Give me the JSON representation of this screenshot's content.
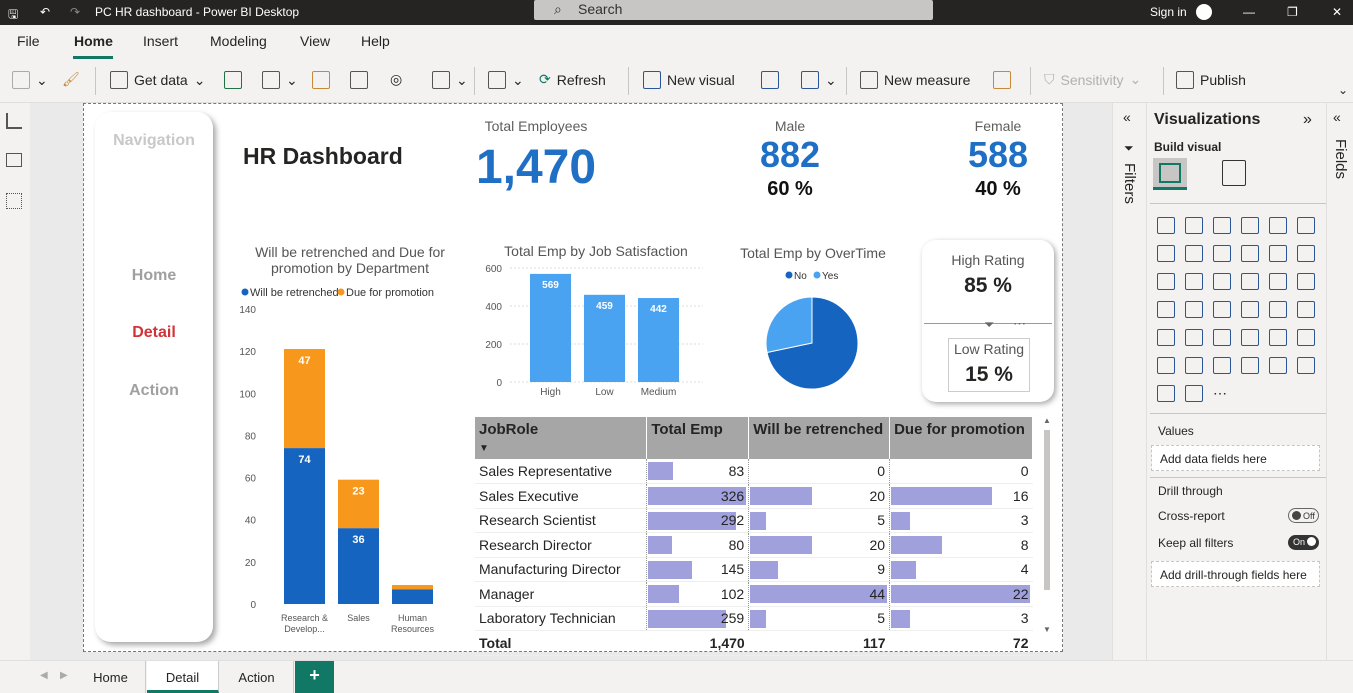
{
  "titlebar": {
    "title": "PC HR dashboard - Power BI Desktop",
    "search_placeholder": "Search",
    "sign_in": "Sign in"
  },
  "menu": [
    "File",
    "Home",
    "Insert",
    "Modeling",
    "View",
    "Help"
  ],
  "ribbon": {
    "get_data": "Get data",
    "refresh": "Refresh",
    "new_visual": "New visual",
    "new_measure": "New measure",
    "sensitivity": "Sensitivity",
    "publish": "Publish"
  },
  "navigation": {
    "title": "Navigation",
    "items": [
      "Home",
      "Detail",
      "Action"
    ],
    "active": "Detail",
    "active_color": "#d13438"
  },
  "report": {
    "title": "HR Dashboard",
    "total_employees": {
      "label": "Total Employees",
      "value": "1,470"
    },
    "male": {
      "label": "Male",
      "value": "882",
      "pct": "60 %"
    },
    "female": {
      "label": "Female",
      "value": "588",
      "pct": "40 %"
    },
    "high_rating": {
      "label": "High Rating",
      "value": "85 %"
    },
    "low_rating": {
      "label": "Low Rating",
      "value": "15 %"
    }
  },
  "chart_data": [
    {
      "type": "bar",
      "stacked": true,
      "title": "Will be retrenched and Due for promotion by Department",
      "categories": [
        "Research & Develop...",
        "Sales",
        "Human Resources"
      ],
      "series": [
        {
          "name": "Will be retrenched",
          "values": [
            74,
            36,
            7
          ],
          "color": "#1565c0"
        },
        {
          "name": "Due for promotion",
          "values": [
            47,
            23,
            2
          ],
          "color": "#f7981d"
        }
      ],
      "yticks": [
        "0",
        "20",
        "40",
        "60",
        "80",
        "100",
        "120",
        "140"
      ],
      "ylim": [
        0,
        140
      ],
      "legend": "top"
    },
    {
      "type": "bar",
      "title": "Total Emp by Job Satisfaction",
      "categories": [
        "High",
        "Low",
        "Medium"
      ],
      "values": [
        569,
        459,
        442
      ],
      "yticks": [
        "0",
        "200",
        "400",
        "600"
      ],
      "ylim": [
        0,
        600
      ],
      "color": "#4aa3f0"
    },
    {
      "type": "pie",
      "title": "Total Emp by OverTime",
      "series": [
        {
          "name": "No",
          "value": 1054,
          "color": "#1565c0"
        },
        {
          "name": "Yes",
          "value": 416,
          "color": "#4aa3f0"
        }
      ],
      "legend": "top"
    }
  ],
  "table": {
    "columns": [
      "JobRole",
      "Total Emp",
      "Will be retrenched",
      "Due for promotion"
    ],
    "rows": [
      {
        "role": "Sales Representative",
        "total": 83,
        "retrenched": 0,
        "promotion": 0
      },
      {
        "role": "Sales Executive",
        "total": 326,
        "retrenched": 20,
        "promotion": 16
      },
      {
        "role": "Research Scientist",
        "total": 292,
        "retrenched": 5,
        "promotion": 3
      },
      {
        "role": "Research Director",
        "total": 80,
        "retrenched": 20,
        "promotion": 8
      },
      {
        "role": "Manufacturing Director",
        "total": 145,
        "retrenched": 9,
        "promotion": 4
      },
      {
        "role": "Manager",
        "total": 102,
        "retrenched": 44,
        "promotion": 22
      },
      {
        "role": "Laboratory Technician",
        "total": 259,
        "retrenched": 5,
        "promotion": 3
      }
    ],
    "total": {
      "label": "Total",
      "total": "1,470",
      "retrenched": "117",
      "promotion": "72"
    }
  },
  "filters_label": "Filters",
  "fields_label": "Fields",
  "visualizations": {
    "title": "Visualizations",
    "build_visual": "Build visual",
    "values_label": "Values",
    "values_placeholder": "Add data fields here",
    "drill_through": "Drill through",
    "cross_report": "Cross-report",
    "cross_report_state": "Off",
    "keep_all_filters": "Keep all filters",
    "keep_all_filters_state": "On",
    "drill_placeholder": "Add drill-through fields here"
  },
  "tabs": [
    "Home",
    "Detail",
    "Action"
  ],
  "active_tab": "Detail"
}
